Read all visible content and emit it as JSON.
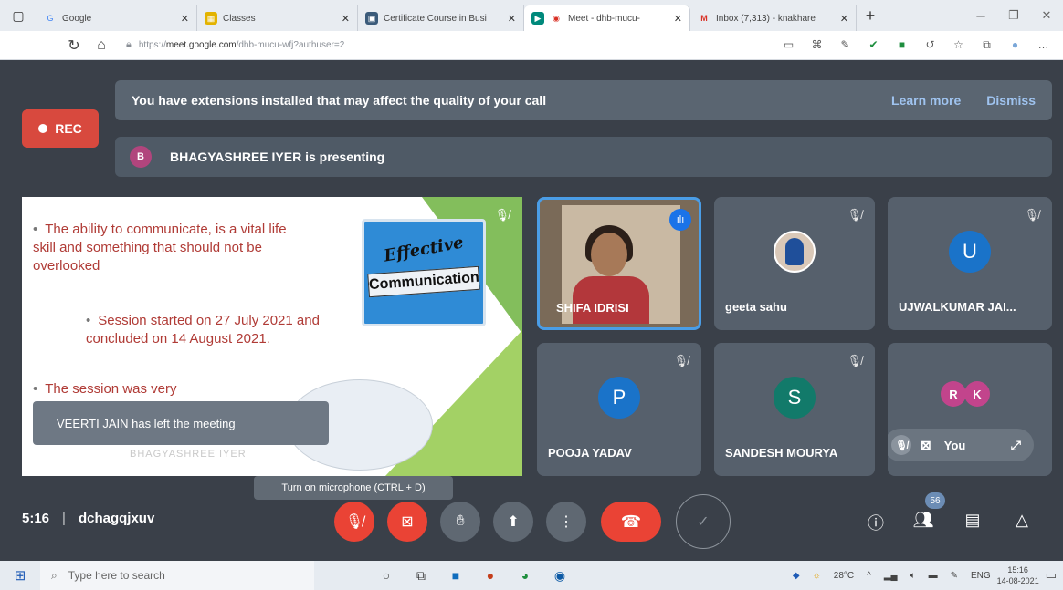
{
  "browser": {
    "tabs": [
      {
        "label": "Google",
        "fav": "G",
        "color": "#4285f4"
      },
      {
        "label": "Classes",
        "fav": "▦",
        "color": "#e3b300"
      },
      {
        "label": "Certificate Course in Busi",
        "fav": "▣",
        "color": "#3b5b7a"
      },
      {
        "label": "Meet - dhb-mucu-",
        "fav": "◉",
        "color": "#d93025"
      },
      {
        "label": "Inbox (7,313) - knakhare",
        "fav": "M",
        "color": "#d93025"
      }
    ],
    "new_tab": "+",
    "url_prefix": "https://",
    "url_host": "meet.google.com",
    "url_path": "/dhb-mucu-wfj?authuser=2"
  },
  "banner": {
    "text": "You have extensions installed that may affect the quality of your call",
    "learn_more": "Learn more",
    "dismiss": "Dismiss"
  },
  "rec_label": "REC",
  "presenting": {
    "initial": "B",
    "text": "BHAGYASHREE IYER is presenting"
  },
  "slide": {
    "bullet1": "The ability to communicate, is a vital life skill and something that should not be overlooked",
    "bullet2": "Session started on 27 July 2021 and concluded on 14 August 2021.",
    "bullet3": "The session was very",
    "graphic_line1": "Effective",
    "graphic_line2": "Communication",
    "watermark": "BHAGYASHREE IYER"
  },
  "toast": "VEERTI JAIN has left the meeting",
  "participants": [
    {
      "name": "SHIFA IDRISI"
    },
    {
      "name": "geeta sahu"
    },
    {
      "name": "UJWALKUMAR JAI...",
      "initial": "U",
      "color": "#1a73c9"
    },
    {
      "name": "POOJA YADAV",
      "initial": "P",
      "color": "#1a73c9"
    },
    {
      "name": "SANDESH MOURYA",
      "initial": "S",
      "color": "#127a6a"
    }
  ],
  "self_tile": {
    "initials": [
      "R",
      "K"
    ],
    "you_label": "You"
  },
  "tooltip": "Turn on microphone (CTRL + D)",
  "meeting": {
    "time": "5:16",
    "code": "dchagqjxuv"
  },
  "participant_count": "56",
  "taskbar": {
    "search_placeholder": "Type here to search",
    "temperature": "28°C",
    "lang": "ENG",
    "time": "15:16",
    "date": "14-08-2021"
  }
}
